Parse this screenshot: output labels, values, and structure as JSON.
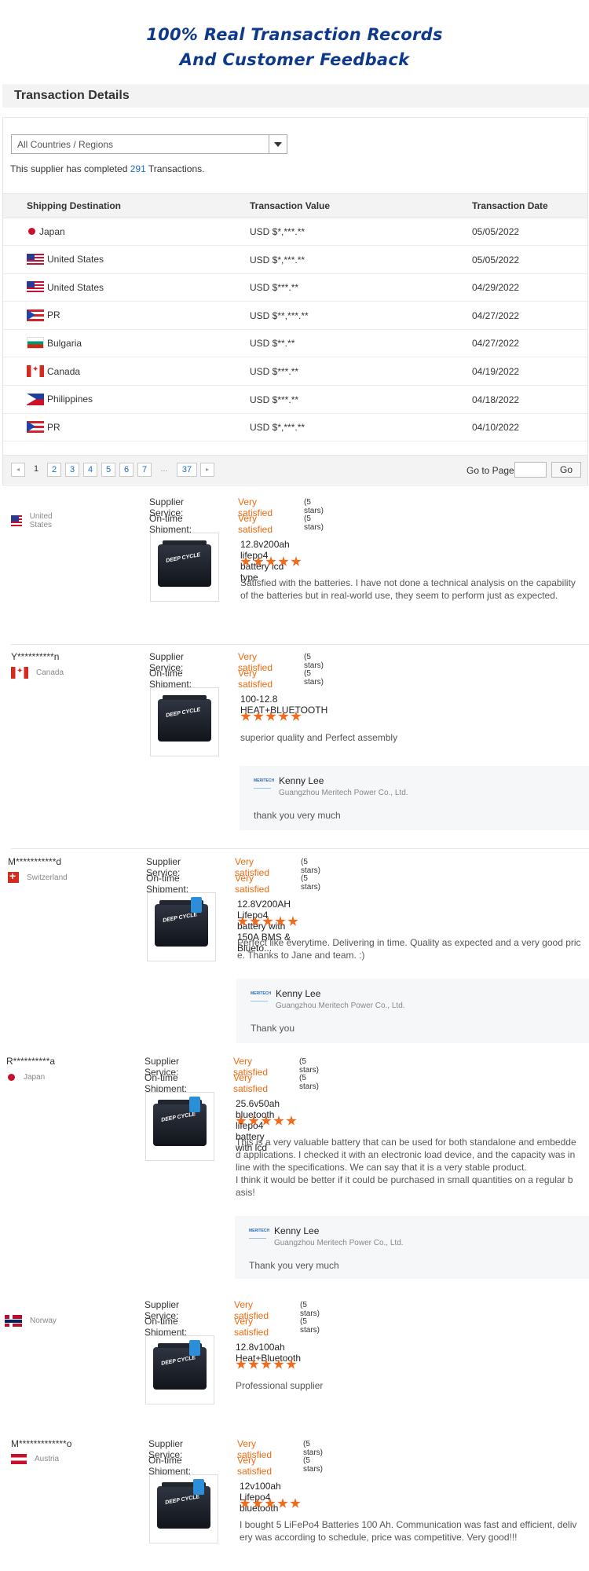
{
  "hero": {
    "title_line1": "100% Real Transaction Records",
    "title_line2": "And Customer Feedback"
  },
  "transaction_details": {
    "heading": "Transaction Details",
    "region_select": "All Countries / Regions",
    "completed_prefix": "This supplier has completed ",
    "completed_count": "291",
    "completed_suffix": " Transactions.",
    "columns": [
      "Shipping Destination",
      "Transaction Value",
      "Transaction Date"
    ],
    "rows": [
      {
        "country": "Japan",
        "flag": "jp",
        "value": "USD $*,***.**",
        "date": "05/05/2022"
      },
      {
        "country": "United States",
        "flag": "us",
        "value": "USD $*,***.**",
        "date": "05/05/2022"
      },
      {
        "country": "United States",
        "flag": "us",
        "value": "USD $***.**",
        "date": "04/29/2022"
      },
      {
        "country": "PR",
        "flag": "pr",
        "value": "USD $**,***.**",
        "date": "04/27/2022"
      },
      {
        "country": "Bulgaria",
        "flag": "bg",
        "value": "USD $**.**",
        "date": "04/27/2022"
      },
      {
        "country": "Canada",
        "flag": "ca",
        "value": "USD $***.**",
        "date": "04/19/2022"
      },
      {
        "country": "Philippines",
        "flag": "ph",
        "value": "USD $***.**",
        "date": "04/18/2022"
      },
      {
        "country": "PR",
        "flag": "pr",
        "value": "USD $*,***.**",
        "date": "04/10/2022"
      }
    ],
    "pagination": {
      "prev": "◂",
      "next": "▸",
      "pages": [
        "1",
        "2",
        "3",
        "4",
        "5",
        "6",
        "7",
        "...",
        "37"
      ],
      "current": "1",
      "goto_label": "Go to Page",
      "go_button": "Go"
    }
  },
  "reviews": {
    "supplier_service_label": "Supplier Service:",
    "ontime_label": "On-time Shipment:",
    "satisfied": "Very satisfied",
    "stars_text": "(5 stars)",
    "battery_label": "DEEP CYCLE",
    "items": [
      {
        "user": "",
        "country": "United States",
        "flag": "us",
        "product": "12.8v200ah lifepo4 battery lcd type",
        "rating": 5,
        "comment": [
          "Satisfied with the batteries. I have not done a technical analysis on the capability",
          "of the batteries but in real-world use, they seem to perform just as expected."
        ],
        "reply": null
      },
      {
        "user": "Y**********n",
        "country": "Canada",
        "flag": "ca",
        "product": "100-12.8 HEAT+BLUETOOTH",
        "rating": 5,
        "comment": [
          "superior quality and Perfect assembly"
        ],
        "reply": {
          "name": "Kenny Lee",
          "company": "Guangzhou Meritech Power Co., Ltd.",
          "text": "thank you very much",
          "logo": "MERITECH"
        }
      },
      {
        "user": "M***********d",
        "country": "Switzerland",
        "flag": "ch",
        "product": "12.8V200AH Lifepo4 battery with 150A BMS & Blueto...",
        "rating": 5,
        "comment": [
          "Perfect like everytime. Delivering in time. Quality as expected and a very good pric",
          "e. Thanks to Jane and team. :)"
        ],
        "reply": {
          "name": "Kenny Lee",
          "company": "Guangzhou Meritech Power Co., Ltd.",
          "text": "Thank  you",
          "logo": "MERITECH"
        }
      },
      {
        "user": "R**********a",
        "country": "Japan",
        "flag": "jp",
        "product": "25.6v50ah bluetooth lifepo4 battery with lcd",
        "rating": 5,
        "comment": [
          "This is a very valuable battery that can be used for both standalone and embedde",
          "d applications. I checked it with an electronic load device, and the capacity was in",
          "line with the specifications. We can say that it is a very stable product.",
          "I think it would be better if it could be purchased in small quantities on a regular b",
          "asis!"
        ],
        "reply": {
          "name": "Kenny Lee",
          "company": "Guangzhou Meritech Power Co., Ltd.",
          "text": "Thank you very much",
          "logo": "MERITECH"
        }
      },
      {
        "user": "",
        "country": "Norway",
        "flag": "no",
        "product": "12.8v100ah Heat+Bluetooth",
        "rating": 5,
        "comment": [
          "Professional supplier"
        ],
        "reply": null
      },
      {
        "user": "M*************o",
        "country": "Austria",
        "flag": "at",
        "product": "12v100ah Lifepo4 bluetooth",
        "rating": 5,
        "comment": [
          "I bought 5 LiFePo4 Batteries 100 Ah. Communication was fast and efficient, deliv",
          "ery was according to schedule, price was competitive. Very good!!!"
        ],
        "reply": null
      }
    ]
  }
}
